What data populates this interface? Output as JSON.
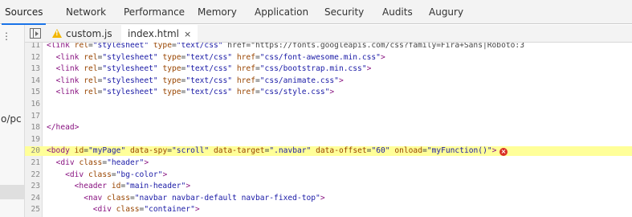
{
  "top_tabs": [
    {
      "label": "Sources",
      "active": true
    },
    {
      "label": "Network"
    },
    {
      "label": "Performance"
    },
    {
      "label": "Memory"
    },
    {
      "label": "Application"
    },
    {
      "label": "Security"
    },
    {
      "label": "Audits"
    },
    {
      "label": "Augury"
    }
  ],
  "navigator": {
    "more_icon": "⋮",
    "partial_text": "o/pc"
  },
  "file_tabs": [
    {
      "label": "custom.js",
      "icon": "warning-icon"
    },
    {
      "label": "index.html",
      "active": true,
      "close": "×"
    }
  ],
  "editor": {
    "lines": [
      {
        "num": "11",
        "text": "<link rel=\"stylesheet\" type=\"text/css\" href=\"https://fonts.googleapis.com/css?family=Fira+Sans|Roboto:3"
      },
      {
        "num": "12",
        "text": "  <link rel=\"stylesheet\" type=\"text/css\" href=\"css/font-awesome.min.css\">"
      },
      {
        "num": "13",
        "text": "  <link rel=\"stylesheet\" type=\"text/css\" href=\"css/bootstrap.min.css\">"
      },
      {
        "num": "14",
        "text": "  <link rel=\"stylesheet\" type=\"text/css\" href=\"css/animate.css\">"
      },
      {
        "num": "15",
        "text": "  <link rel=\"stylesheet\" type=\"text/css\" href=\"css/style.css\">"
      },
      {
        "num": "16",
        "text": ""
      },
      {
        "num": "17",
        "text": ""
      },
      {
        "num": "18",
        "text": "</head>"
      },
      {
        "num": "19",
        "text": ""
      },
      {
        "num": "20",
        "text": "<body id=\"myPage\" data-spy=\"scroll\" data-target=\".navbar\" data-offset=\"60\" onload=\"myFunction()\">",
        "highlight": true,
        "error": true
      },
      {
        "num": "21",
        "text": "  <div class=\"header\">"
      },
      {
        "num": "22",
        "text": "    <div class=\"bg-color\">"
      },
      {
        "num": "23",
        "text": "      <header id=\"main-header\">"
      },
      {
        "num": "24",
        "text": "        <nav class=\"navbar navbar-default navbar-fixed-top\">"
      },
      {
        "num": "25",
        "text": "          <div class=\"container\">"
      }
    ]
  },
  "colors": {
    "highlight": "#ffff99",
    "tag": "#881280",
    "attr": "#994500",
    "value": "#1a1aa6",
    "error": "#d93025",
    "active_tab_underline": "#1a73e8"
  }
}
